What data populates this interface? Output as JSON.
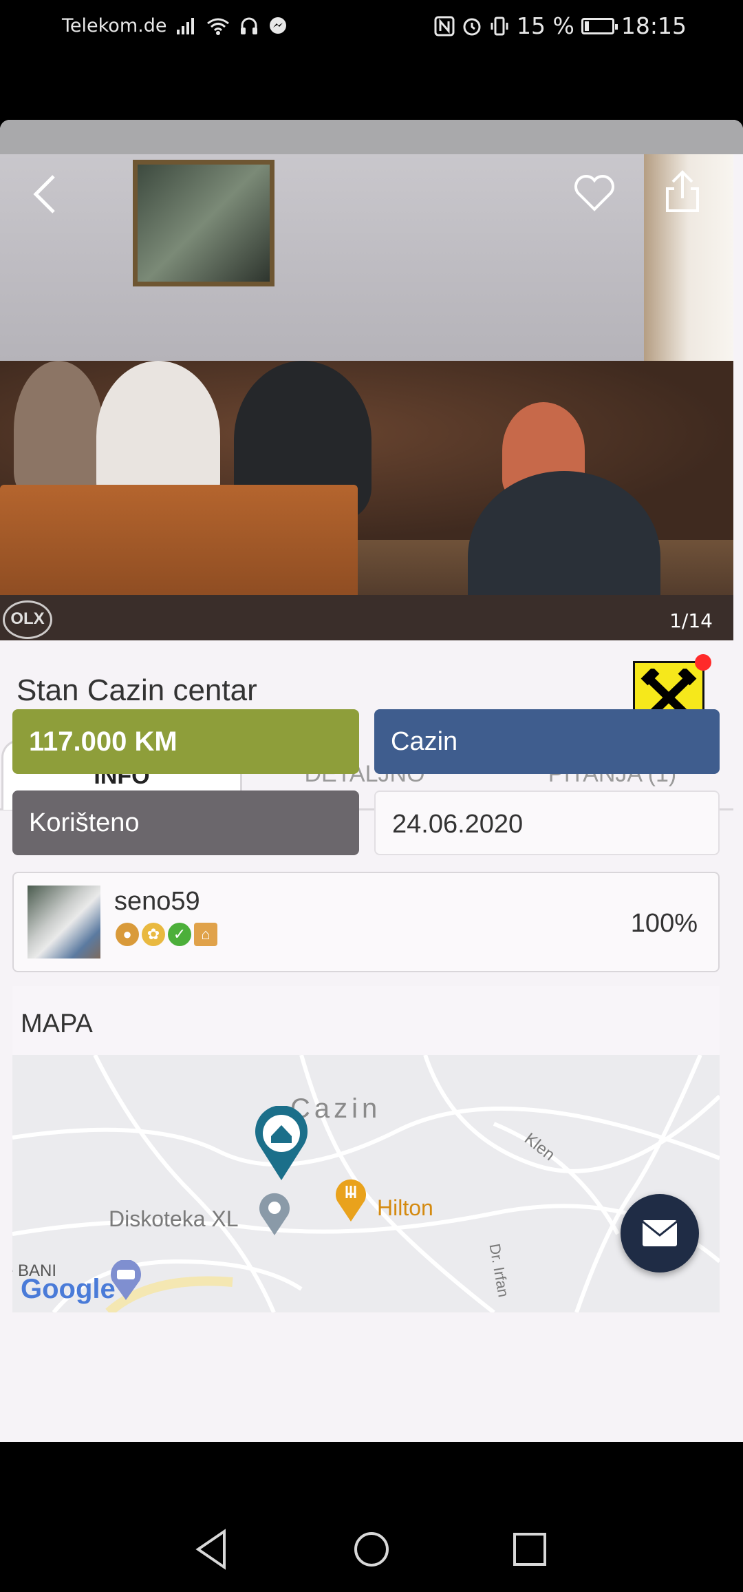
{
  "status_bar": {
    "carrier": "Telekom.de",
    "battery": "15 %",
    "battery_level": 0.15,
    "time": "18:15"
  },
  "listing": {
    "image_counter": "1/14",
    "watermark": "OLX",
    "title": "Stan Cazin centar"
  },
  "tabs": [
    {
      "label": "INFO",
      "active": true
    },
    {
      "label": "DETALJNO",
      "active": false
    },
    {
      "label": "PITANJA (1)",
      "active": false
    }
  ],
  "info": {
    "price": "117.000 KM",
    "city": "Cazin",
    "condition": "Korišteno",
    "date": "24.06.2020"
  },
  "seller": {
    "username": "seno59",
    "rating": "100%",
    "badges": [
      "medal-badge",
      "award-badge",
      "shield-check-badge",
      "home-badge"
    ]
  },
  "map": {
    "heading": "MAPA",
    "labels": {
      "town": "Cazin",
      "club": "Diskoteka XL",
      "hotel": "Hilton",
      "street1": "Klen",
      "street2": "Dr. Irfan",
      "google": "Google",
      "partial": "e BANI"
    }
  },
  "colors": {
    "price_bg": "#8e9e3a",
    "city_bg": "#3f5d8e",
    "condition_bg": "#6b676c",
    "fab_bg": "#1f2c45",
    "pin_blue": "#1b6f8a",
    "pin_orange": "#e9a21c"
  }
}
